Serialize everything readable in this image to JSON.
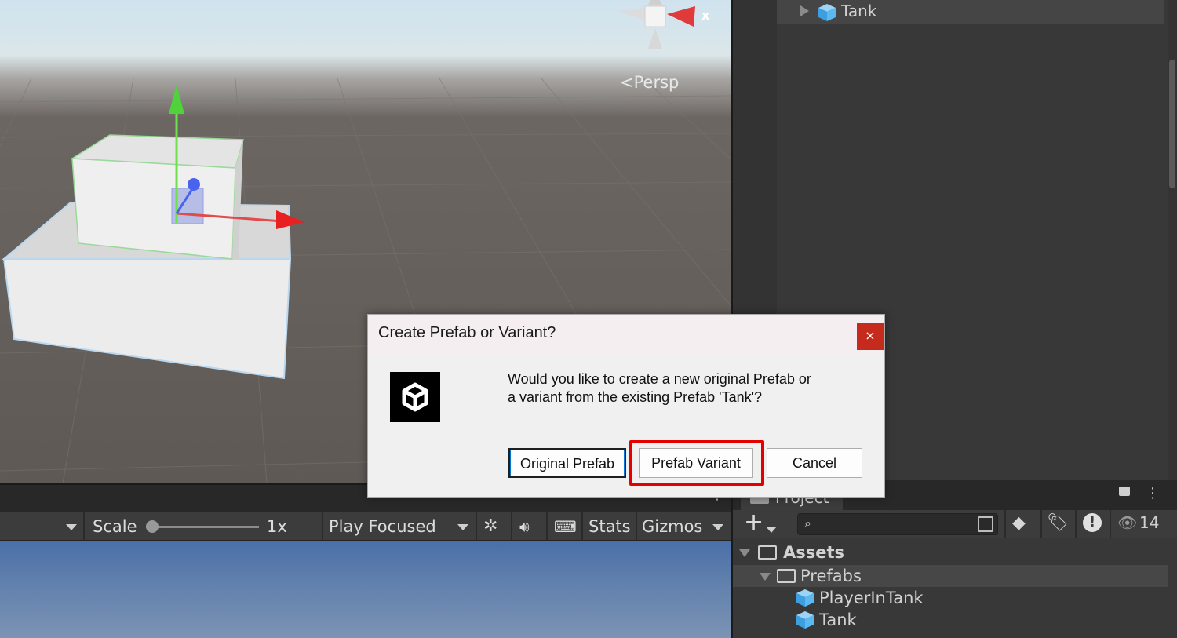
{
  "scene": {
    "camera_label": "Persp",
    "axis_label": "x"
  },
  "hierarchy": {
    "items": [
      {
        "label": "Tank"
      }
    ]
  },
  "game_toolbar": {
    "scale_label": "Scale",
    "scale_value": "1x",
    "play_mode": "Play Focused",
    "stats_label": "Stats",
    "gizmos_label": "Gizmos"
  },
  "project": {
    "tab_label": "Project",
    "search_placeholder": "",
    "hidden_count": "14",
    "tree": [
      {
        "label": "Assets",
        "type": "folder",
        "expanded": true
      },
      {
        "label": "Prefabs",
        "type": "folder",
        "expanded": true
      },
      {
        "label": "PlayerInTank",
        "type": "prefab"
      },
      {
        "label": "Tank",
        "type": "prefab"
      }
    ]
  },
  "dialog": {
    "title": "Create Prefab or Variant?",
    "close_glyph": "×",
    "message_line1": "Would you like to create a new original Prefab or",
    "message_line2": "a variant from the existing Prefab 'Tank'?",
    "buttons": {
      "original": "Original Prefab",
      "variant": "Prefab Variant",
      "cancel": "Cancel"
    },
    "highlighted_button": "variant"
  },
  "colors": {
    "highlight": "#e50000",
    "close_button": "#c42b1c",
    "prefab_icon": "#5bb8f0"
  }
}
